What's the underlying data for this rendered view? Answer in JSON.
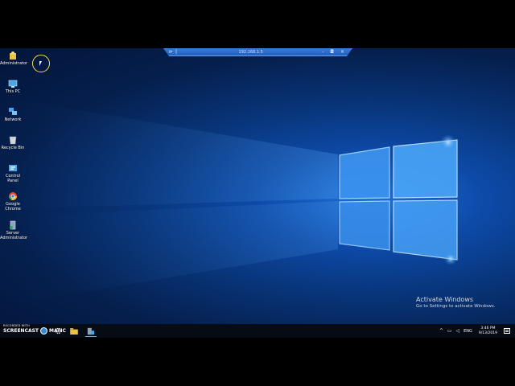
{
  "remote_session_bar": {
    "address": "192.168.1.5",
    "controls": "- ◘ ×",
    "pin_symbol": "⊳|"
  },
  "desktop_icons": [
    {
      "label": "Administrator",
      "icon": "user-folder-icon",
      "color": "#e8c24a"
    },
    {
      "label": "This PC",
      "icon": "computer-icon",
      "color": "#4aa6e8"
    },
    {
      "label": "Network",
      "icon": "network-icon",
      "color": "#4aa6e8"
    },
    {
      "label": "Recycle Bin",
      "icon": "recycle-bin-icon",
      "color": "#cfd6de"
    },
    {
      "label": "Control Panel",
      "icon": "control-panel-icon",
      "color": "#4aa6e8"
    },
    {
      "label": "Google Chrome",
      "icon": "chrome-icon",
      "color": "#e04a3a"
    },
    {
      "label": "Server Administrator",
      "icon": "server-admin-icon",
      "color": "#8aa4c0"
    }
  ],
  "watermark": {
    "recorded_with": "RECORDED WITH",
    "brand_left": "SCREENCAST",
    "brand_right": "MATIC"
  },
  "activation": {
    "title": "Activate Windows",
    "subtitle": "Go to Settings to activate Windows."
  },
  "taskbar": {
    "apps": [
      "file-explorer-icon",
      "server-manager-icon"
    ],
    "tray_chevron": "^",
    "language": "ENG",
    "time": "3:46 PM",
    "date": "9/13/2019"
  },
  "colors": {
    "accent": "#1f5fbf",
    "cursor_highlight": "#f4e04a",
    "window_light": "#6fc2ff"
  }
}
